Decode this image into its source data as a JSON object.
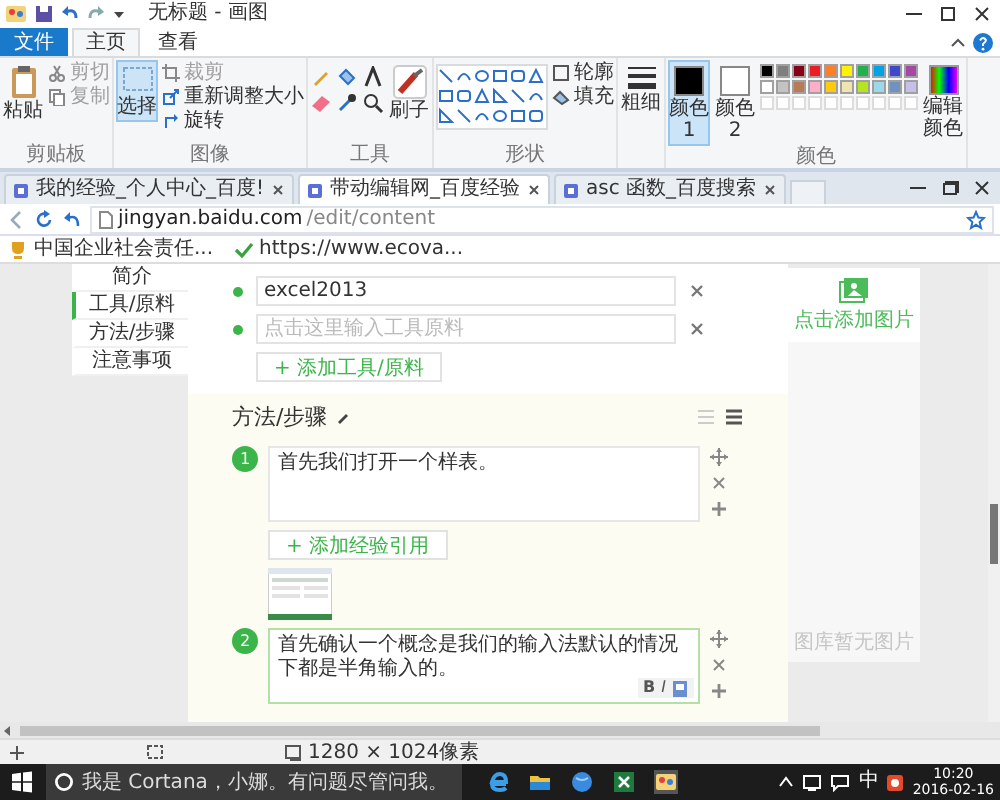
{
  "window": {
    "title": "无标题 - 画图"
  },
  "ribbon_tabs": [
    {
      "label": "文件",
      "kind": "file",
      "selected": false
    },
    {
      "label": "主页",
      "kind": "tab",
      "selected": true
    },
    {
      "label": "查看",
      "kind": "tab",
      "selected": false
    }
  ],
  "clipboard": {
    "label": "剪贴板",
    "paste": "粘贴",
    "cut": {
      "label": "剪切",
      "disabled": true
    },
    "copy": {
      "label": "复制",
      "disabled": true
    }
  },
  "image": {
    "label": "图像",
    "select": {
      "label": "选择",
      "selected": true
    },
    "crop": {
      "label": "裁剪",
      "disabled": true
    },
    "resize": "重新调整大小",
    "rotate": "旋转"
  },
  "tools": {
    "label": "工具",
    "brushes": "刷子"
  },
  "shapes": {
    "label": "形状",
    "outline": "轮廓",
    "fill": "填充"
  },
  "size": "粗细",
  "colors": {
    "label": "颜色",
    "slots": [
      {
        "label": "颜色 1",
        "color": "#000000",
        "selected": true
      },
      {
        "label": "颜色 2",
        "color": "#ffffff",
        "selected": false
      }
    ],
    "palette": [
      {
        "color": "#000000"
      },
      {
        "color": "#7f7f7f"
      },
      {
        "color": "#880015"
      },
      {
        "color": "#ed1c24"
      },
      {
        "color": "#ff7f27"
      },
      {
        "color": "#fff200"
      },
      {
        "color": "#22b14c"
      },
      {
        "color": "#00a2e8"
      },
      {
        "color": "#3f48cc"
      },
      {
        "color": "#a349a4"
      },
      {
        "color": "#ffffff"
      },
      {
        "color": "#c3c3c3"
      },
      {
        "color": "#b97a57"
      },
      {
        "color": "#ffaec9"
      },
      {
        "color": "#ffc90e"
      },
      {
        "color": "#efe4b0"
      },
      {
        "color": "#b5e61d"
      },
      {
        "color": "#99d9ea"
      },
      {
        "color": "#7092be"
      },
      {
        "color": "#c8bfe7"
      }
    ],
    "edit": "编辑颜色"
  },
  "browser": {
    "tabs": [
      {
        "title": "我的经验_个人中心_百度!",
        "selected": false
      },
      {
        "title": "带动编辑网_百度经验",
        "selected": true
      },
      {
        "title": "asc 函数_百度搜索",
        "selected": false
      }
    ],
    "host": "jingyan.baidu.com",
    "path": "/edit/content",
    "bookmarks": [
      "中国企业社会责任...",
      "https://www.ecova..."
    ]
  },
  "page": {
    "nav": [
      {
        "label": "简介",
        "selected": false
      },
      {
        "label": "工具/原料",
        "selected": true
      },
      {
        "label": "方法/步骤",
        "selected": false
      },
      {
        "label": "注意事项",
        "selected": false
      }
    ],
    "tool_fields": [
      {
        "value": "excel2013"
      },
      {
        "placeholder": "点击这里输入工具原料"
      }
    ],
    "add_tool": "+ 添加工具/原料",
    "section_title": "方法/步骤",
    "steps": [
      {
        "number": "1",
        "text": "首先我们打开一个样表。",
        "focused": false,
        "add_reference": "+ 添加经验引用"
      },
      {
        "number": "2",
        "text": "首先确认一个概念是我们的输入法默认的情况下都是半角输入的。",
        "focused": true,
        "format_buttons": [
          "B",
          "I"
        ]
      }
    ],
    "image_panel": {
      "add": "点击添加图片",
      "empty": "图库暂无图片"
    }
  },
  "status_bar": {
    "size": "1280 × 1024像素"
  },
  "taskbar": {
    "search": "我是 Cortana，小娜。有问题尽管问我。",
    "ime": "中",
    "time": "10:20",
    "date": "2016-02-16"
  }
}
